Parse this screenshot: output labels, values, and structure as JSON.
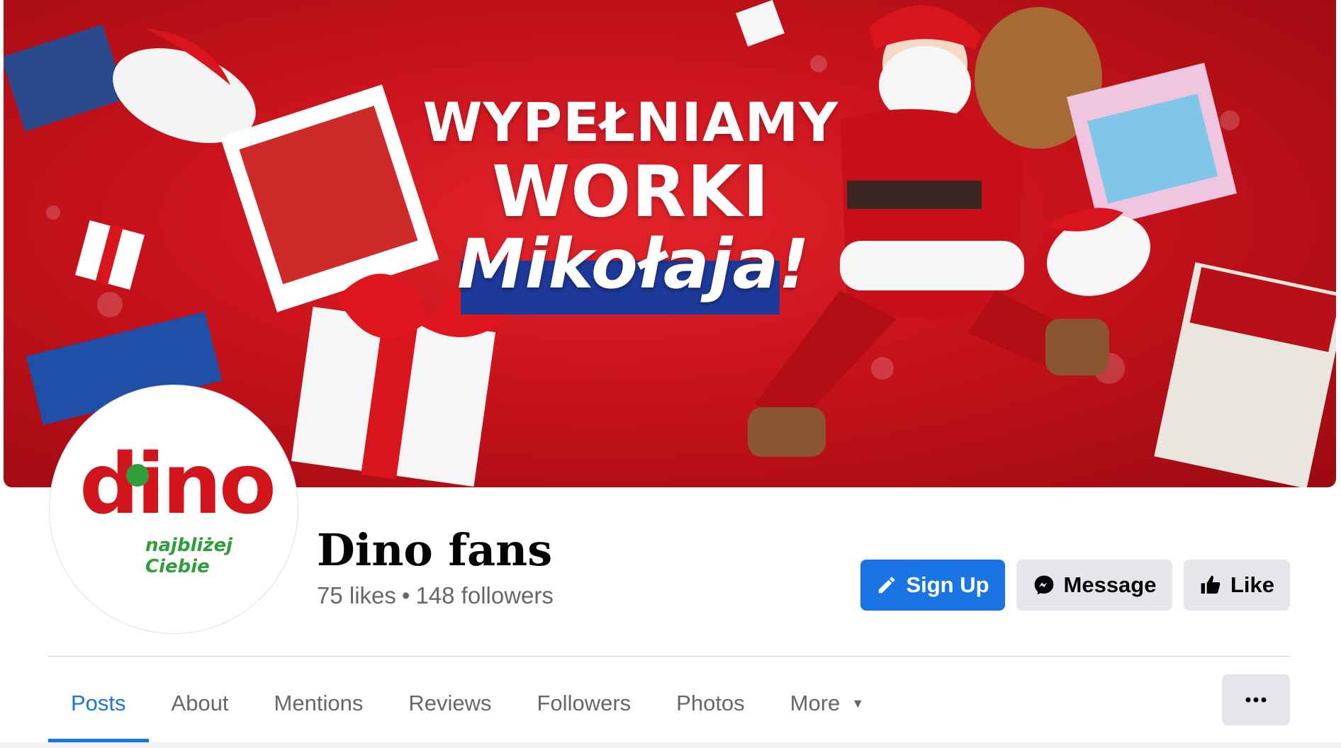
{
  "cover": {
    "headline_line1": "WYPEŁNIAMY",
    "headline_line2": "WORKI",
    "headline_script": "Mikołaja!",
    "colors": {
      "background": "#c8121b",
      "script_box": "#1d3a9a"
    }
  },
  "profile": {
    "logo_word": "dino",
    "logo_tagline": "najbliżej Ciebie",
    "name": "Dino fans",
    "likes": "75 likes",
    "separator": "•",
    "followers": "148 followers"
  },
  "actions": {
    "signup_label": "Sign Up",
    "message_label": "Message",
    "like_label": "Like",
    "signup_icon": "pencil-icon",
    "message_icon": "messenger-icon",
    "like_icon": "thumbs-up-icon"
  },
  "tabs": [
    {
      "label": "Posts",
      "active": true
    },
    {
      "label": "About"
    },
    {
      "label": "Mentions"
    },
    {
      "label": "Reviews"
    },
    {
      "label": "Followers"
    },
    {
      "label": "Photos"
    },
    {
      "label": "More"
    }
  ],
  "colors": {
    "accent": "#1b74e4",
    "secondary_button": "#e4e6eb",
    "muted_text": "#65676b",
    "logo_red": "#d2141c",
    "logo_green": "#2f9e3a"
  }
}
